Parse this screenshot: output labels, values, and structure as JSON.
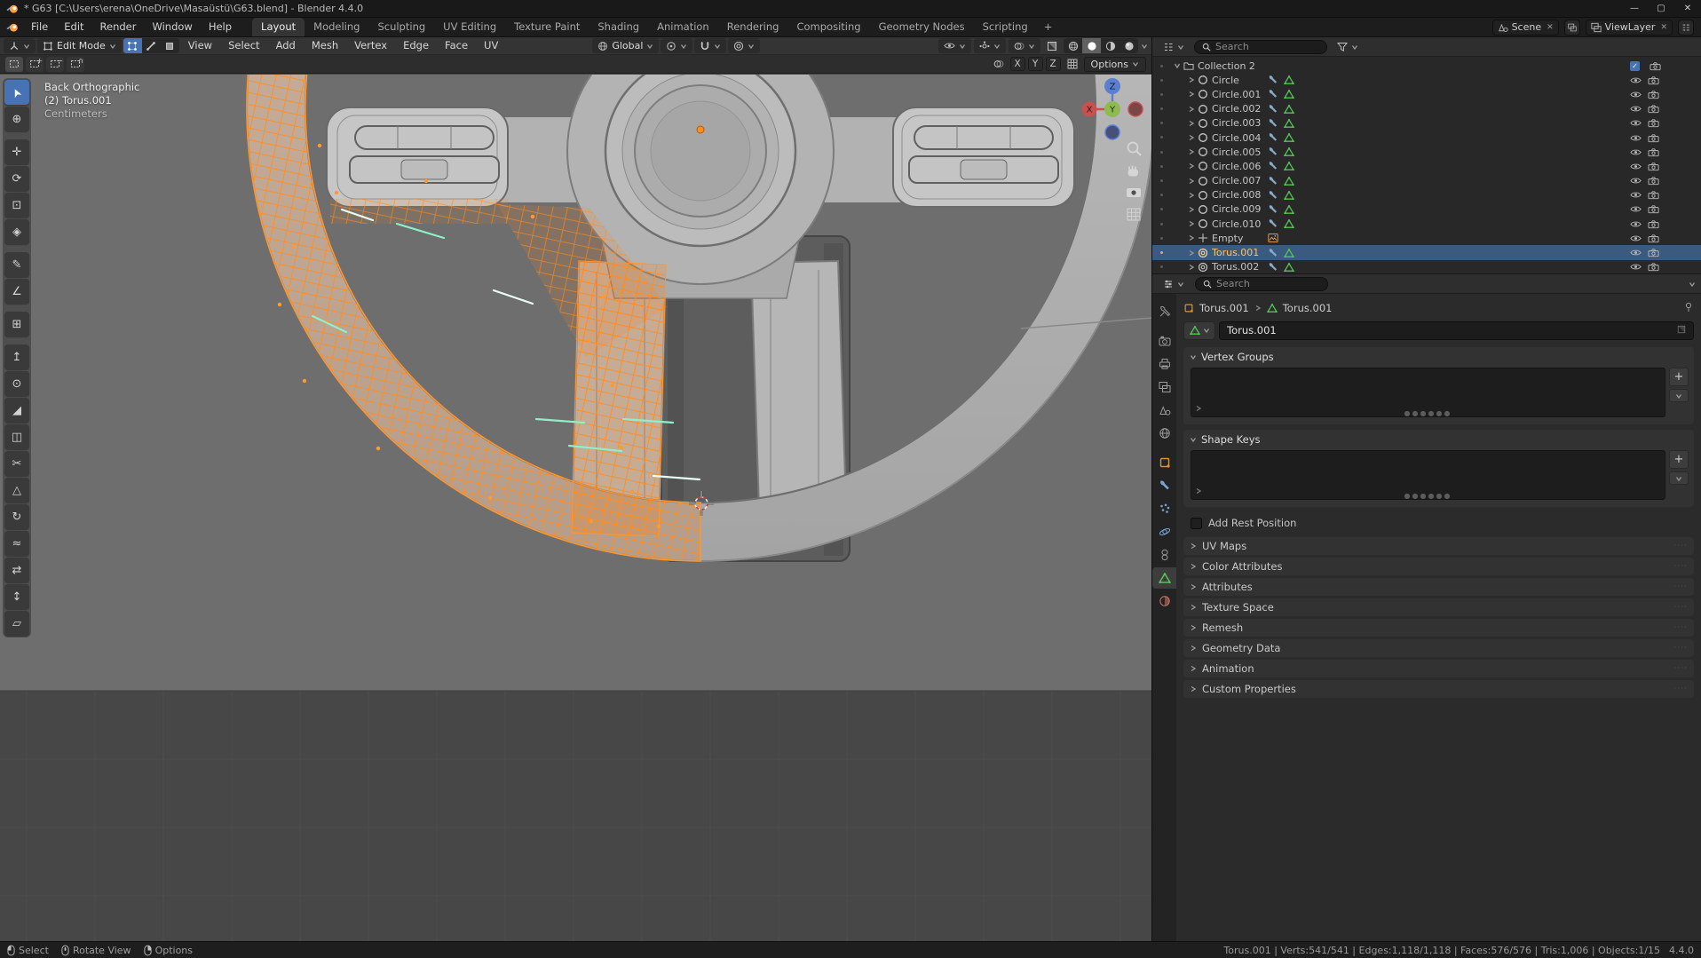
{
  "window": {
    "title": "* G63 [C:\\Users\\erena\\OneDrive\\Masaüstü\\G63.blend] - Blender 4.4.0",
    "controls": {
      "minimize": "—",
      "maximize": "▢",
      "close": "✕"
    }
  },
  "topbar": {
    "menus": [
      "File",
      "Edit",
      "Render",
      "Window",
      "Help"
    ],
    "workspaces": [
      "Layout",
      "Modeling",
      "Sculpting",
      "UV Editing",
      "Texture Paint",
      "Shading",
      "Animation",
      "Rendering",
      "Compositing",
      "Geometry Nodes",
      "Scripting"
    ],
    "active_workspace": "Layout",
    "add_workspace": "+",
    "scene_name": "Scene",
    "view_layer_name": "ViewLayer",
    "close_glyph": "✕"
  },
  "viewport": {
    "header": {
      "mode": "Edit Mode",
      "menus": [
        "View",
        "Select",
        "Add",
        "Mesh",
        "Vertex",
        "Edge",
        "Face",
        "UV"
      ],
      "orientation": "Global",
      "options_label": "Options",
      "mirror_axes": [
        "X",
        "Y",
        "Z"
      ],
      "select_mode_signs": [
        "",
        "+",
        "−",
        "∩"
      ]
    },
    "overlay": {
      "line1": "Back Orthographic",
      "line2": "(2) Torus.001",
      "line3": "Centimeters"
    },
    "gizmo": {
      "x": "X",
      "y": "Y",
      "z": "Z"
    }
  },
  "toolbar": {
    "tools": [
      {
        "name": "tweak-select",
        "glyph": "➤"
      },
      {
        "name": "cursor",
        "glyph": "⊕"
      },
      {
        "name": "move",
        "glyph": "✛"
      },
      {
        "name": "rotate",
        "glyph": "⟳"
      },
      {
        "name": "scale",
        "glyph": "⊡"
      },
      {
        "name": "transform",
        "glyph": "◈"
      },
      {
        "name": "annotate",
        "glyph": "✎"
      },
      {
        "name": "measure",
        "glyph": "∠"
      },
      {
        "name": "add-cube",
        "glyph": "⊞"
      },
      {
        "name": "extrude-region",
        "glyph": "↥"
      },
      {
        "name": "inset-faces",
        "glyph": "⊙"
      },
      {
        "name": "bevel",
        "glyph": "◢"
      },
      {
        "name": "loop-cut",
        "glyph": "◫"
      },
      {
        "name": "knife",
        "glyph": "✂"
      },
      {
        "name": "poly-build",
        "glyph": "△"
      },
      {
        "name": "spin",
        "glyph": "↻"
      },
      {
        "name": "smooth",
        "glyph": "≈"
      },
      {
        "name": "edge-slide",
        "glyph": "⇄"
      },
      {
        "name": "shrink-fatten",
        "glyph": "↕"
      },
      {
        "name": "shear",
        "glyph": "▱"
      }
    ]
  },
  "outliner": {
    "search_placeholder": "Search",
    "rows": [
      {
        "name": "Collection 2",
        "type": "collection"
      },
      {
        "name": "Circle",
        "type": "mesh"
      },
      {
        "name": "Circle.001",
        "type": "mesh"
      },
      {
        "name": "Circle.002",
        "type": "mesh"
      },
      {
        "name": "Circle.003",
        "type": "mesh"
      },
      {
        "name": "Circle.004",
        "type": "mesh"
      },
      {
        "name": "Circle.005",
        "type": "mesh"
      },
      {
        "name": "Circle.006",
        "type": "mesh"
      },
      {
        "name": "Circle.007",
        "type": "mesh"
      },
      {
        "name": "Circle.008",
        "type": "mesh"
      },
      {
        "name": "Circle.009",
        "type": "mesh"
      },
      {
        "name": "Circle.010",
        "type": "mesh"
      },
      {
        "name": "Empty",
        "type": "empty"
      },
      {
        "name": "Torus.001",
        "type": "mesh",
        "active": true
      },
      {
        "name": "Torus.002",
        "type": "mesh"
      }
    ]
  },
  "properties": {
    "search_placeholder": "Search",
    "breadcrumb": {
      "object": "Torus.001",
      "data": "Torus.001"
    },
    "name_field": "Torus.001",
    "panels": {
      "vertex_groups": "Vertex Groups",
      "shape_keys": "Shape Keys",
      "add_rest_position": "Add Rest Position",
      "collapsed": [
        "UV Maps",
        "Color Attributes",
        "Attributes",
        "Texture Space",
        "Remesh",
        "Geometry Data",
        "Animation",
        "Custom Properties"
      ]
    }
  },
  "statusbar": {
    "hints": [
      {
        "label": "Select"
      },
      {
        "label": "Rotate View"
      },
      {
        "label": "Options"
      }
    ],
    "stats": "Torus.001 | Verts:541/541 | Edges:1,118/1,118 | Faces:576/576 | Tris:1,006 | Objects:1/15",
    "version": "4.4.0"
  },
  "colors": {
    "selection_orange": "#ff8d1f",
    "active_blue": "#4772b3",
    "mesh_green": "#56c456",
    "axis_x": "#c85050",
    "axis_y": "#8fba52",
    "axis_z": "#5b7fd0"
  }
}
